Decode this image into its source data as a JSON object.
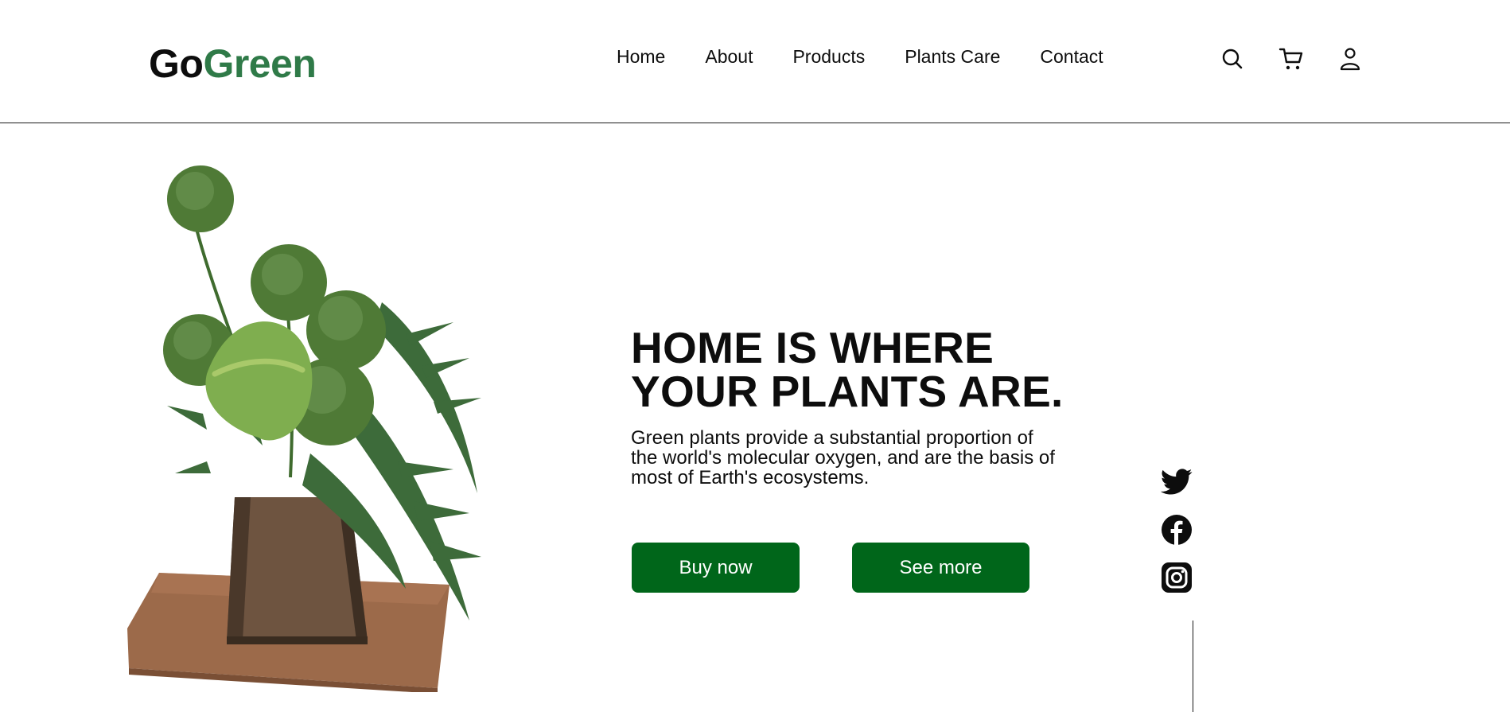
{
  "brand": {
    "part1": "Go",
    "part2": "Green",
    "accent": "#2f7a48"
  },
  "nav": {
    "items": [
      {
        "label": "Home"
      },
      {
        "label": "About"
      },
      {
        "label": "Products"
      },
      {
        "label": "Plants Care"
      },
      {
        "label": "Contact"
      }
    ]
  },
  "header_icons": [
    "search-icon",
    "cart-icon",
    "user-icon"
  ],
  "hero": {
    "title_line1": "HOME IS WHERE",
    "title_line2": "YOUR PLANTS ARE.",
    "description": "Green plants provide a substantial proportion of the world's molecular oxygen, and are the basis of most of Earth's ecosystems.",
    "buy_label": "Buy now",
    "see_more_label": "See more",
    "button_color": "#00661a"
  },
  "social": [
    "twitter-icon",
    "facebook-icon",
    "instagram-icon"
  ]
}
